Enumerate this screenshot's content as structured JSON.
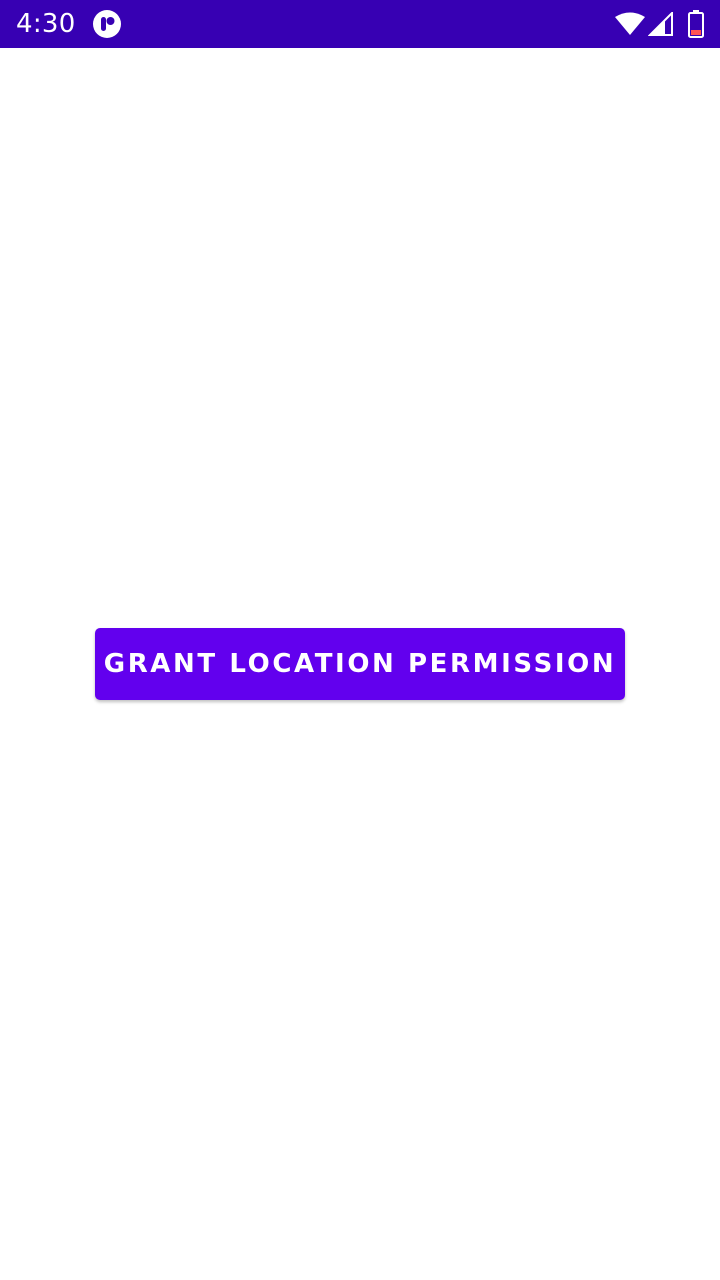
{
  "status_bar": {
    "time": "4:30",
    "background_color": "#3700b3",
    "icons": [
      "app-notification-icon",
      "wifi-icon",
      "cell-signal-icon",
      "battery-icon"
    ]
  },
  "main": {
    "grant_button_label": "GRANT LOCATION PERMISSION",
    "accent_color": "#6200ee"
  }
}
